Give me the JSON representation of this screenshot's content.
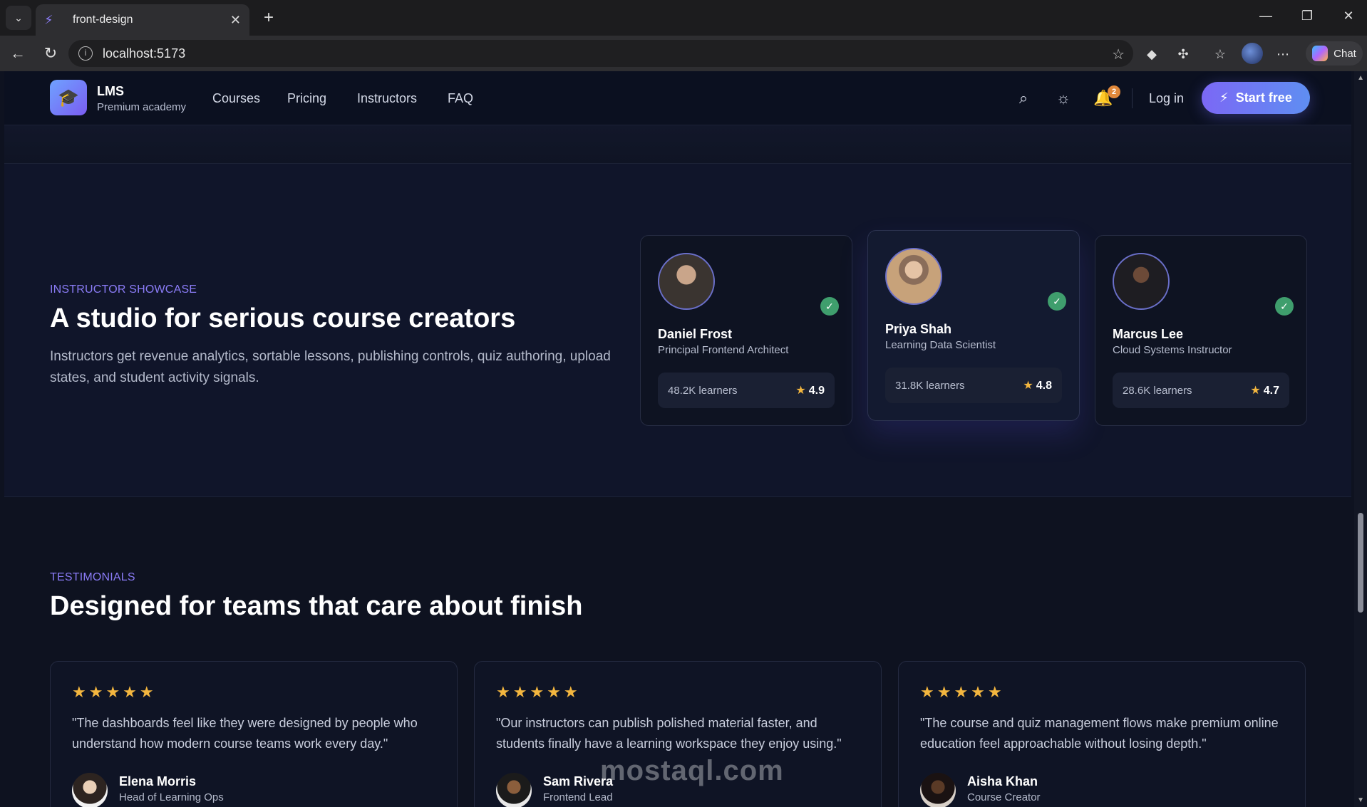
{
  "browser": {
    "tab_title": "front-design",
    "url": "localhost:5173",
    "chat_label": "Chat"
  },
  "header": {
    "brand_title": "LMS",
    "brand_subtitle": "Premium academy",
    "nav": [
      "Courses",
      "Pricing",
      "Instructors",
      "FAQ"
    ],
    "notification_count": "2",
    "login_label": "Log in",
    "start_label": "Start free"
  },
  "showcase": {
    "eyebrow": "INSTRUCTOR SHOWCASE",
    "title": "A studio for serious course creators",
    "description": "Instructors get revenue analytics, sortable lessons, publishing controls, quiz authoring, upload states, and student activity signals.",
    "instructors": [
      {
        "name": "Daniel Frost",
        "role": "Principal Frontend Architect",
        "learners": "48.2K learners",
        "rating": "4.9"
      },
      {
        "name": "Priya Shah",
        "role": "Learning Data Scientist",
        "learners": "31.8K learners",
        "rating": "4.8"
      },
      {
        "name": "Marcus Lee",
        "role": "Cloud Systems Instructor",
        "learners": "28.6K learners",
        "rating": "4.7"
      }
    ]
  },
  "testimonials": {
    "eyebrow": "TESTIMONIALS",
    "title": "Designed for teams that care about finish",
    "items": [
      {
        "quote": "\"The dashboards feel like they were designed by people who understand how modern course teams work every day.\"",
        "name": "Elena Morris",
        "role": "Head of Learning Ops",
        "stars": 5
      },
      {
        "quote": "\"Our instructors can publish polished material faster, and students finally have a learning workspace they enjoy using.\"",
        "name": "Sam Rivera",
        "role": "Frontend Lead",
        "stars": 5
      },
      {
        "quote": "\"The course and quiz management flows make premium online education feel approachable without losing depth.\"",
        "name": "Aisha Khan",
        "role": "Course Creator",
        "stars": 5
      }
    ]
  },
  "watermark": "mostaql.com",
  "icons": {
    "star": "★",
    "check": "✓"
  },
  "colors": {
    "accent": "#8b7cf7",
    "star": "#f3b63f",
    "verified": "#3f9e6d",
    "badge": "#e0883b"
  }
}
